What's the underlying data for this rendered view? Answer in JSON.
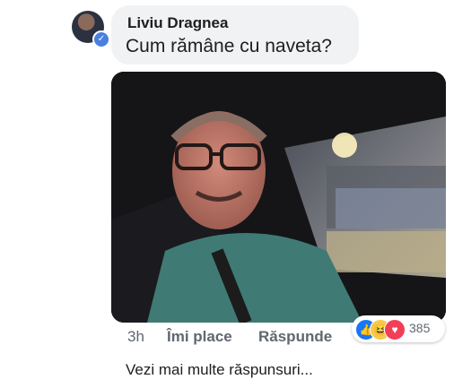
{
  "comment": {
    "author": "Liviu Dragnea",
    "text": "Cum rămâne cu naveta?",
    "time": "3h",
    "like_label": "Îmi place",
    "reply_label": "Răspunde"
  },
  "reactions": {
    "icons": [
      "like-icon",
      "haha-icon",
      "love-icon"
    ],
    "count": "385"
  },
  "more_replies": "Vezi mai multe răspunsuri...",
  "colors": {
    "bubble": "#f1f2f4",
    "text": "#1c1e21",
    "meta": "#606770",
    "like": "#1877f2",
    "love": "#f33e58",
    "haha": "#f7c94a"
  }
}
